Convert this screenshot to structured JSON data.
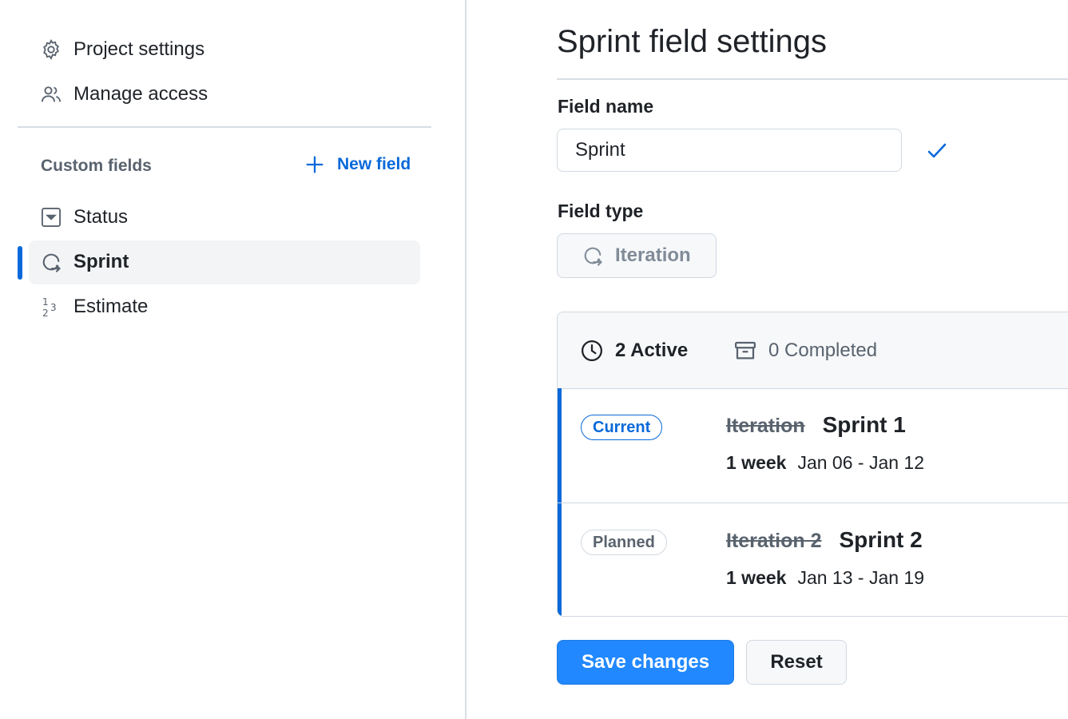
{
  "sidebar": {
    "top_items": [
      {
        "label": "Project settings",
        "icon": "gear-icon"
      },
      {
        "label": "Manage access",
        "icon": "people-icon"
      }
    ],
    "section_label": "Custom fields",
    "new_field_label": "New field",
    "fields": [
      {
        "label": "Status",
        "icon": "single-select-icon",
        "active": false
      },
      {
        "label": "Sprint",
        "icon": "iteration-icon",
        "active": true
      },
      {
        "label": "Estimate",
        "icon": "number-icon",
        "active": false
      }
    ]
  },
  "main": {
    "title": "Sprint field settings",
    "field_name_label": "Field name",
    "field_name_value": "Sprint",
    "field_type_label": "Field type",
    "field_type_value": "Iteration",
    "tabs": {
      "active": "2 Active",
      "completed": "0 Completed"
    },
    "iterations": [
      {
        "status": "Current",
        "old_name": "Iteration",
        "name": "Sprint 1",
        "duration": "1 week",
        "dates": "Jan 06 - Jan 12"
      },
      {
        "status": "Planned",
        "old_name": "Iteration 2",
        "name": "Sprint 2",
        "duration": "1 week",
        "dates": "Jan 13 - Jan 19"
      }
    ],
    "save_label": "Save changes",
    "reset_label": "Reset"
  },
  "colors": {
    "accent": "#0969da",
    "primary_button": "#2188ff",
    "muted_text": "#59636e"
  }
}
